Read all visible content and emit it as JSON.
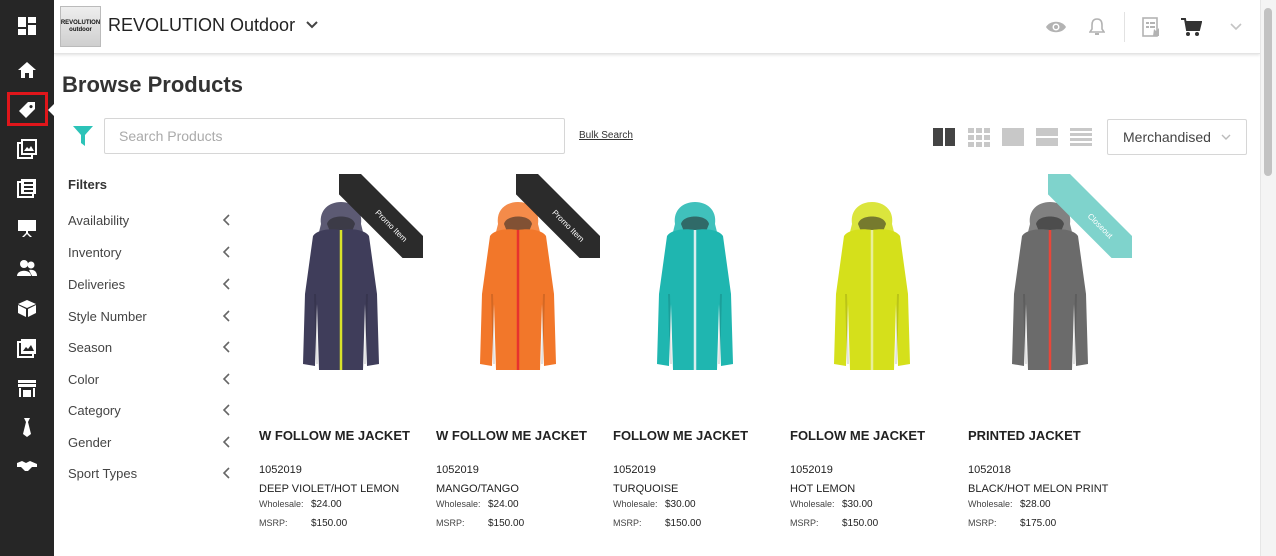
{
  "app": {
    "store_name": "REVOLUTION Outdoor",
    "logo_line1": "REVOLUTION",
    "logo_line2": "outdoor"
  },
  "rail": {
    "items": [
      {
        "name": "dashboard-icon"
      },
      {
        "name": "home-icon"
      },
      {
        "name": "tag-icon",
        "active": true
      },
      {
        "name": "linesheet-icon"
      },
      {
        "name": "catalog-icon"
      },
      {
        "name": "presentation-icon"
      },
      {
        "name": "customers-icon"
      },
      {
        "name": "box-icon"
      },
      {
        "name": "gallery-icon"
      },
      {
        "name": "storefront-icon"
      },
      {
        "name": "tie-icon"
      },
      {
        "name": "handshake-icon"
      }
    ]
  },
  "header": {
    "icons": [
      "eye-icon",
      "bell-icon",
      "order-icon",
      "cart-icon",
      "chevron-down-icon"
    ]
  },
  "main": {
    "title": "Browse Products",
    "search_placeholder": "Search Products",
    "bulk_search": "Bulk Search",
    "sort_value": "Merchandised",
    "view_modes": [
      "large-grid",
      "small-grid",
      "single",
      "list",
      "compact-list"
    ],
    "active_view": "large-grid"
  },
  "filters": {
    "title": "Filters",
    "items": [
      "Availability",
      "Inventory",
      "Deliveries",
      "Style Number",
      "Season",
      "Color",
      "Category",
      "Gender",
      "Sport Types"
    ]
  },
  "labels": {
    "wholesale": "Wholesale:",
    "msrp": "MSRP:"
  },
  "products": [
    {
      "name": "W FOLLOW ME JACKET",
      "style": "1052019",
      "color": "DEEP VIOLET/HOT LEMON",
      "wholesale": "$24.00",
      "msrp": "$150.00",
      "ribbon": "Promo Item",
      "ribbon_color": "#2b2b2b",
      "body_color": "#3f3d5a",
      "accent_color": "#d8e22a"
    },
    {
      "name": "W FOLLOW ME JACKET",
      "style": "1052019",
      "color": "MANGO/TANGO",
      "wholesale": "$24.00",
      "msrp": "$150.00",
      "ribbon": "Promo Item",
      "ribbon_color": "#2b2b2b",
      "body_color": "#f2772a",
      "accent_color": "#e7322e"
    },
    {
      "name": "FOLLOW ME JACKET",
      "style": "1052019",
      "color": "TURQUOISE",
      "wholesale": "$30.00",
      "msrp": "$150.00",
      "ribbon": "",
      "ribbon_color": "",
      "body_color": "#1fb6b0",
      "accent_color": "#d9eeee"
    },
    {
      "name": "FOLLOW ME JACKET",
      "style": "1052019",
      "color": "HOT LEMON",
      "wholesale": "$30.00",
      "msrp": "$150.00",
      "ribbon": "",
      "ribbon_color": "",
      "body_color": "#d5e01b",
      "accent_color": "#e9ef9a"
    },
    {
      "name": "PRINTED JACKET",
      "style": "1052018",
      "color": "BLACK/HOT MELON PRINT",
      "wholesale": "$28.00",
      "msrp": "$175.00",
      "ribbon": "Closeout",
      "ribbon_color": "#7fd3cc",
      "body_color": "#6b6b6b",
      "accent_color": "#e8463a"
    }
  ]
}
